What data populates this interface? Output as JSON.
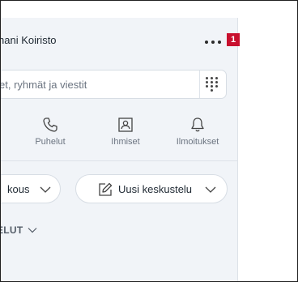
{
  "header": {
    "profile_name": "hani Koiristo",
    "notification_count": "1"
  },
  "search": {
    "placeholder_visible": "et, ryhmät ja viestit"
  },
  "nav": {
    "items": [
      {
        "label": "Puhelut",
        "icon": "phone-icon"
      },
      {
        "label": "Ihmiset",
        "icon": "contacts-icon"
      },
      {
        "label": "Ilmoitukset",
        "icon": "bell-icon"
      }
    ]
  },
  "actions": {
    "meeting_label": "kous",
    "new_chat_label": "Uusi keskustelu"
  },
  "section": {
    "label": "ELUT"
  },
  "colors": {
    "panel_bg": "#f1f4f8",
    "badge": "#c8102e"
  }
}
